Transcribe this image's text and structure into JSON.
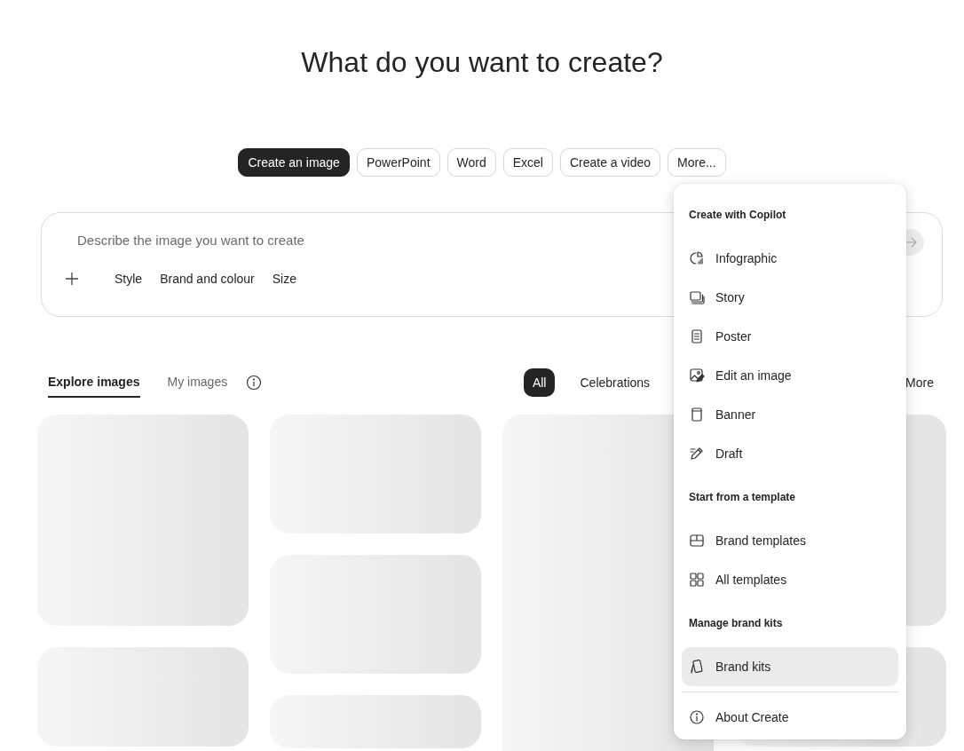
{
  "heading": "What do you want to create?",
  "create_chips": [
    {
      "label": "Create an image",
      "selected": true
    },
    {
      "label": "PowerPoint",
      "selected": false
    },
    {
      "label": "Word",
      "selected": false
    },
    {
      "label": "Excel",
      "selected": false
    },
    {
      "label": "Create a video",
      "selected": false
    },
    {
      "label": "More...",
      "selected": false
    }
  ],
  "prompt": {
    "placeholder": "Describe the image you want to create",
    "options": [
      "Style",
      "Brand and colour",
      "Size"
    ]
  },
  "gallery_tabs": [
    {
      "label": "Explore images",
      "selected": true
    },
    {
      "label": "My images",
      "selected": false
    }
  ],
  "filters": [
    {
      "label": "All",
      "selected": true
    },
    {
      "label": "Celebrations",
      "selected": false
    },
    {
      "label": "More",
      "selected": false
    }
  ],
  "more_menu": {
    "sections": [
      {
        "heading": "Create with Copilot",
        "items": [
          {
            "label": "Infographic",
            "kind": "infographic",
            "selected": false
          },
          {
            "label": "Story",
            "kind": "story",
            "selected": false
          },
          {
            "label": "Poster",
            "kind": "poster",
            "selected": false
          },
          {
            "label": "Edit an image",
            "kind": "edit-image",
            "selected": false
          },
          {
            "label": "Banner",
            "kind": "banner",
            "selected": false
          },
          {
            "label": "Draft",
            "kind": "draft",
            "selected": false
          }
        ]
      },
      {
        "heading": "Start from a template",
        "items": [
          {
            "label": "Brand templates",
            "kind": "brand-templates",
            "selected": false
          },
          {
            "label": "All templates",
            "kind": "all-templates",
            "selected": false
          }
        ]
      },
      {
        "heading": "Manage brand kits",
        "items": [
          {
            "label": "Brand kits",
            "kind": "brand-kits",
            "selected": true
          }
        ]
      },
      {
        "items": [
          {
            "label": "About Create",
            "kind": "about",
            "selected": false
          }
        ]
      }
    ]
  }
}
